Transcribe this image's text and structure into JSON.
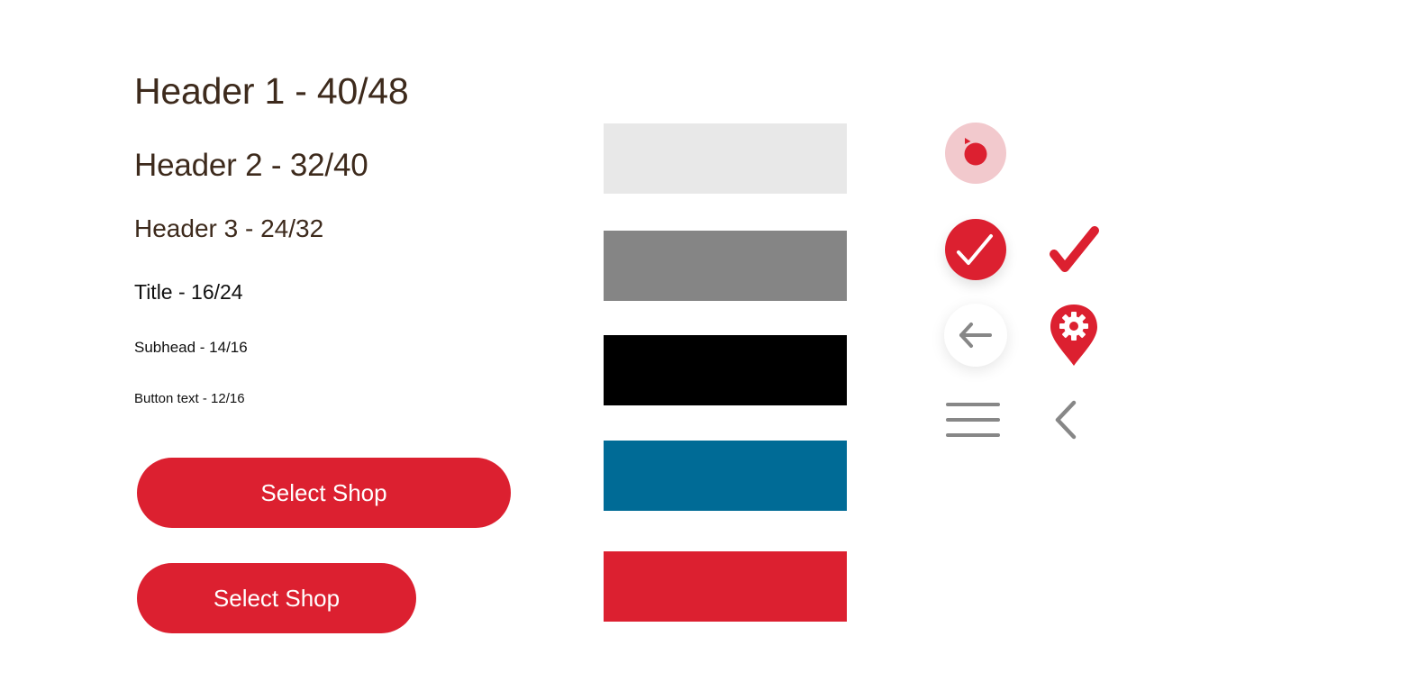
{
  "typography": {
    "header1": "Header 1 - 40/48",
    "header2": "Header 2 - 32/40",
    "header3": "Header 3 - 24/32",
    "title": "Title - 16/24",
    "subhead": "Subhead - 14/16",
    "button_text": "Button text - 12/16"
  },
  "buttons": {
    "primary_wide_label": "Select Shop",
    "primary_narrow_label": "Select Shop"
  },
  "colors": {
    "heading_text": "#3d2a1c",
    "body_text": "#111111",
    "brand_red": "#dc2030",
    "swatches": [
      {
        "name": "light-gray",
        "hex": "#e8e8e8"
      },
      {
        "name": "mid-gray",
        "hex": "#858585"
      },
      {
        "name": "black",
        "hex": "#000000"
      },
      {
        "name": "blue",
        "hex": "#006b96"
      },
      {
        "name": "red",
        "hex": "#dc2030"
      }
    ],
    "record_bg": "#f2c9cd",
    "icon_gray": "#878787"
  },
  "icons": [
    {
      "name": "record-icon"
    },
    {
      "name": "check-circle-icon"
    },
    {
      "name": "check-icon"
    },
    {
      "name": "arrow-left-icon"
    },
    {
      "name": "location-settings-icon"
    },
    {
      "name": "menu-icon"
    },
    {
      "name": "chevron-left-icon"
    }
  ]
}
